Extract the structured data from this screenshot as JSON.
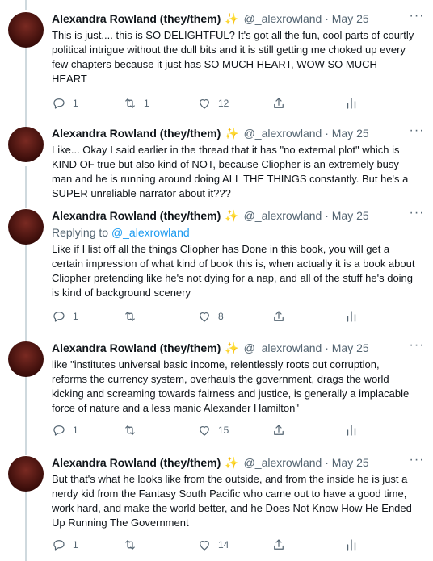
{
  "author": {
    "name": "Alexandra Rowland (they/them)",
    "badge": "✨",
    "handle": "@_alexrowland"
  },
  "tweets": [
    {
      "date": "May 25",
      "text": "This is just.... this is SO DELIGHTFUL? It's got all the fun, cool parts of courtly political intrigue without the dull bits and it is still getting me choked up every few chapters because it just has SO MUCH HEART, WOW SO MUCH HEART",
      "replies": "1",
      "retweets": "1",
      "likes": "12"
    },
    {
      "date": "May 25",
      "text": "Like... Okay I said earlier in the thread that it has \"no external plot\" which is KIND OF true but also kind of NOT, because Cliopher is an extremely busy man and he is running around doing ALL THE THINGS constantly. But he's a SUPER unreliable narrator about it???",
      "replies": "",
      "retweets": "",
      "likes": ""
    },
    {
      "date": "May 25",
      "replying_label": "Replying to",
      "replying_to": "@_alexrowland",
      "text": "Like if I list off all the things Cliopher has Done in this book, you will get a certain impression of what kind of book this is, when actually it is a book about Cliopher pretending like he's not dying for a nap, and all of the stuff he's doing is kind of background scenery",
      "replies": "1",
      "retweets": "",
      "likes": "8"
    },
    {
      "date": "May 25",
      "text": "like \"institutes universal basic income, relentlessly roots out corruption, reforms the currency system, overhauls the government, drags the world kicking and screaming towards fairness and justice, is generally a  implacable force of nature and a less manic Alexander Hamilton\"",
      "replies": "1",
      "retweets": "",
      "likes": "15"
    },
    {
      "date": "May 25",
      "text": "But that's what he looks like from the outside, and from the inside he is just a nerdy kid from the Fantasy South Pacific who came out to have a good time, work hard, and make the world better, and he Does Not Know How He Ended Up Running The Government",
      "replies": "1",
      "retweets": "",
      "likes": "14"
    }
  ],
  "icons": {
    "reply": "reply-icon",
    "retweet": "retweet-icon",
    "like": "like-icon",
    "share": "share-icon",
    "analytics": "analytics-icon",
    "more": "more-icon"
  },
  "colors": {
    "accent": "#1d9bf0",
    "muted": "#536471",
    "thread_line": "#cfd9de"
  }
}
